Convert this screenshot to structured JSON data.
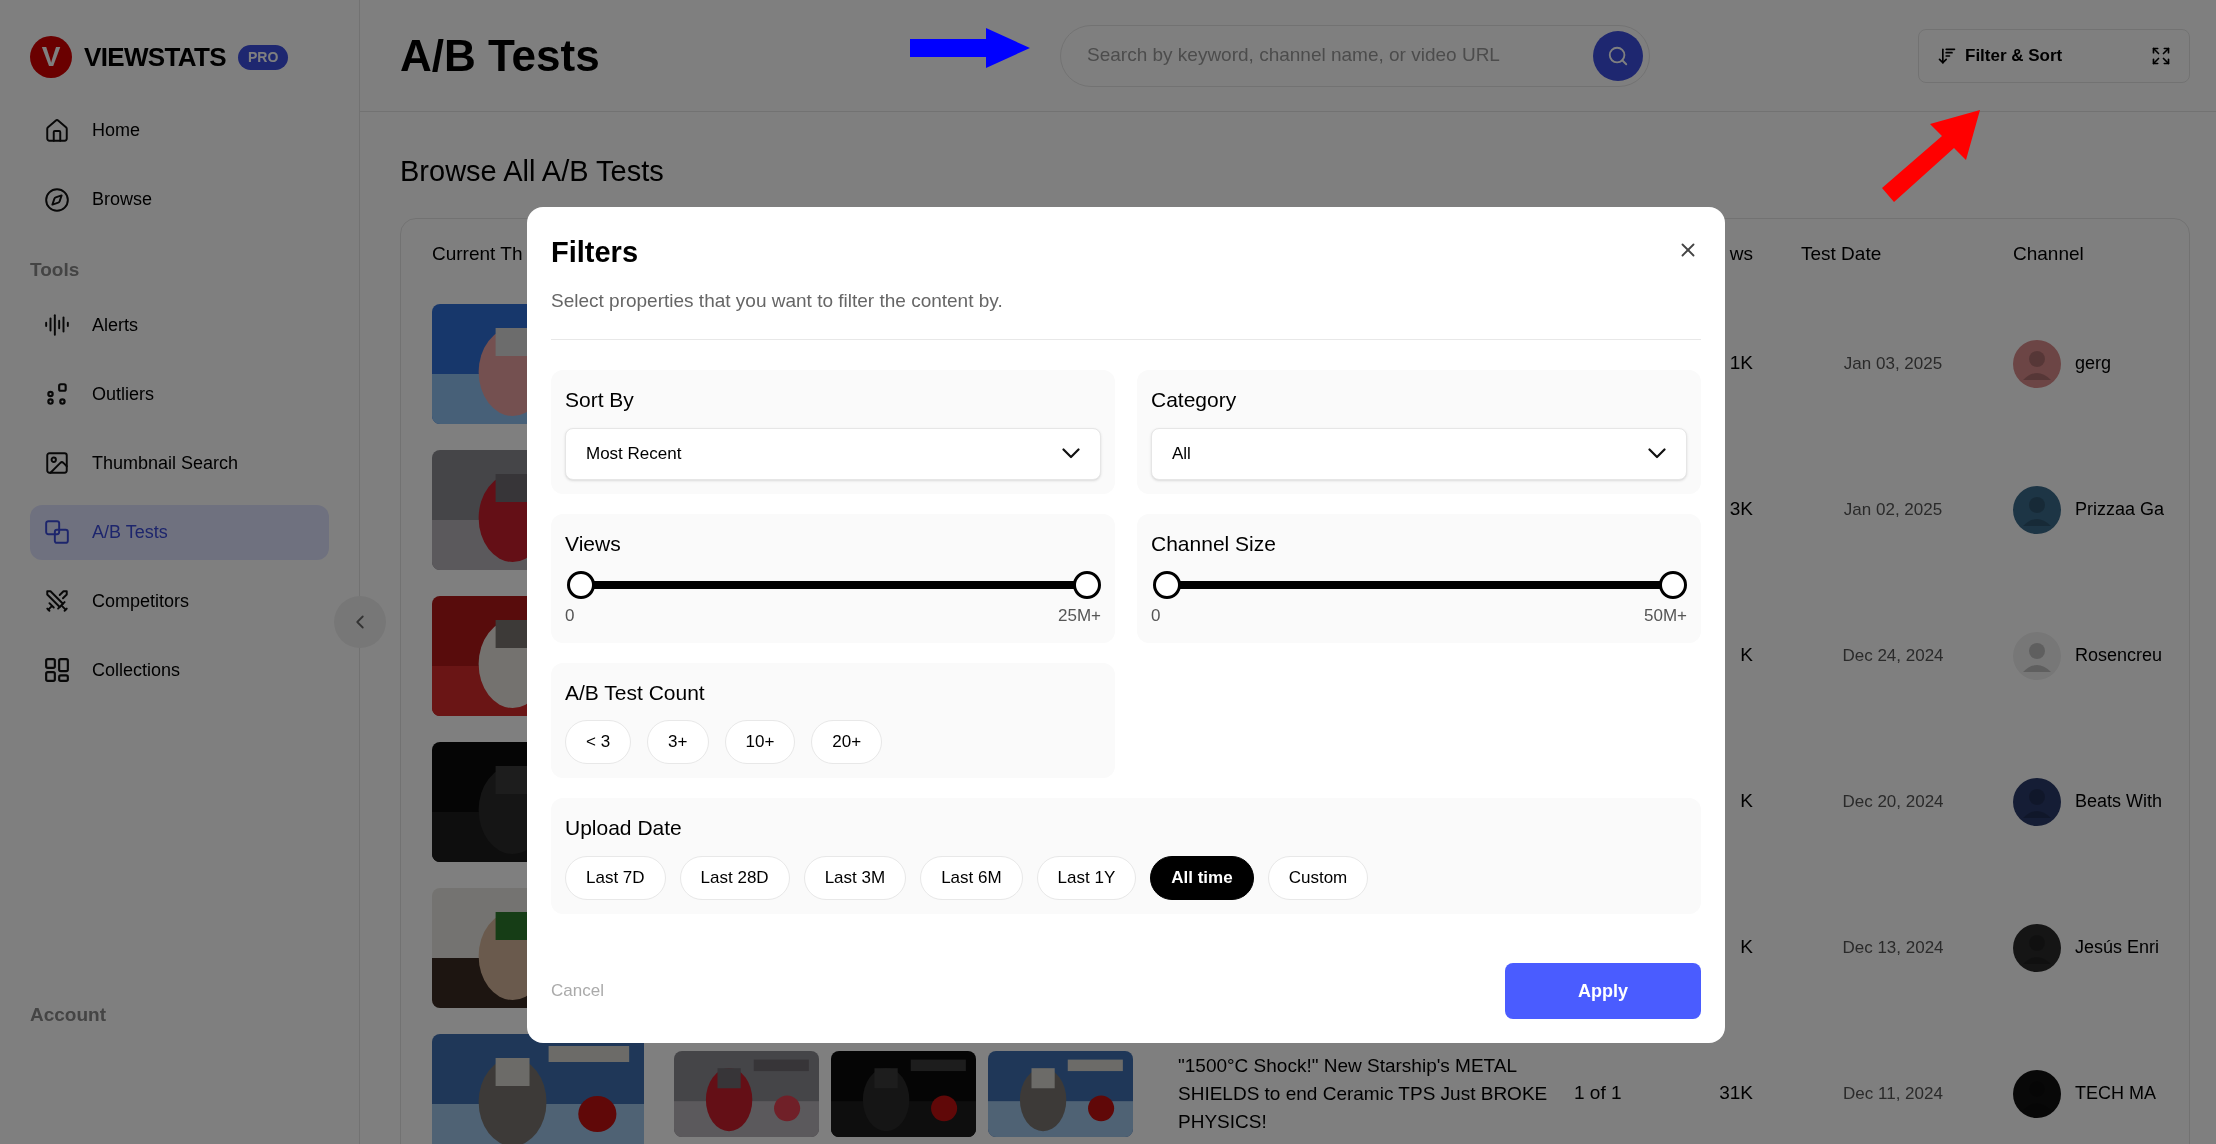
{
  "sidebar": {
    "logo_letter": "V",
    "brand": "VIEWSTATS",
    "badge": "PRO",
    "groups": [
      {
        "items": [
          {
            "label": "Home",
            "selected": false
          },
          {
            "label": "Browse",
            "selected": false
          }
        ]
      },
      {
        "heading": "Tools",
        "items": [
          {
            "label": "Alerts",
            "selected": false
          },
          {
            "label": "Outliers",
            "selected": false
          },
          {
            "label": "Thumbnail Search",
            "selected": false
          },
          {
            "label": "A/B Tests",
            "selected": true
          },
          {
            "label": "Competitors",
            "selected": false
          },
          {
            "label": "Collections",
            "selected": false
          }
        ]
      },
      {
        "heading": "Account"
      }
    ]
  },
  "header": {
    "title": "A/B Tests",
    "search": {
      "placeholder": "Search by keyword, channel name, or video URL"
    },
    "filter_button": "Filter & Sort"
  },
  "section_title": "Browse All A/B Tests",
  "table": {
    "columns": {
      "thumbnails": "Current Th",
      "views": "ws",
      "test_date": "Test Date",
      "channel": "Channel"
    },
    "rows": [
      {
        "views": "1K",
        "test_date": "Jan 03, 2025",
        "channel": "gerg"
      },
      {
        "views": "3K",
        "test_date": "Jan 02, 2025",
        "channel": "Prizzaa Ga"
      },
      {
        "views": "K",
        "test_date": "Dec 24, 2024",
        "channel": "Rosencreu"
      },
      {
        "views": "K",
        "test_date": "Dec 20, 2024",
        "channel": "Beats With"
      },
      {
        "views": "K",
        "test_date": "Dec 13, 2024",
        "channel": "Jesús Enri"
      },
      {
        "title": "\"1500°C Shock!\" New Starship's METAL SHIELDS to end Ceramic TPS Just BROKE PHYSICS!",
        "test_count": "1 of 1",
        "views": "31K",
        "test_date": "Dec 11, 2024",
        "channel": "TECH MA"
      }
    ]
  },
  "filters_dialog": {
    "title": "Filters",
    "subtitle": "Select properties that you want to filter the content by.",
    "sort_by": {
      "label": "Sort By",
      "value": "Most Recent"
    },
    "category": {
      "label": "Category",
      "value": "All"
    },
    "views": {
      "label": "Views",
      "min": "0",
      "max": "25M+",
      "level": 1
    },
    "channel_size": {
      "label": "Channel Size",
      "min": "0",
      "max": "50M+",
      "level": 1
    },
    "test_count": {
      "label": "A/B Test Count",
      "options": [
        {
          "label": "< 3",
          "selected": false
        },
        {
          "label": "3+",
          "selected": false
        },
        {
          "label": "10+",
          "selected": false
        },
        {
          "label": "20+",
          "selected": false
        }
      ]
    },
    "upload_date": {
      "label": "Upload Date",
      "options": [
        {
          "label": "Last 7D",
          "selected": false
        },
        {
          "label": "Last 28D",
          "selected": false
        },
        {
          "label": "Last 3M",
          "selected": false
        },
        {
          "label": "Last 6M",
          "selected": false
        },
        {
          "label": "Last 1Y",
          "selected": false
        },
        {
          "label": "All time",
          "selected": true
        },
        {
          "label": "Custom",
          "selected": false
        }
      ]
    },
    "cancel": "Cancel",
    "apply": "Apply"
  }
}
